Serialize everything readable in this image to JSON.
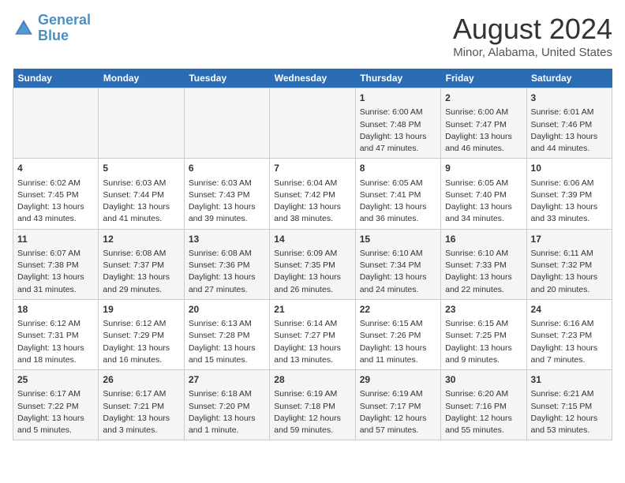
{
  "header": {
    "logo_line1": "General",
    "logo_line2": "Blue",
    "title": "August 2024",
    "subtitle": "Minor, Alabama, United States"
  },
  "days_of_week": [
    "Sunday",
    "Monday",
    "Tuesday",
    "Wednesday",
    "Thursday",
    "Friday",
    "Saturday"
  ],
  "weeks": [
    [
      {
        "day": "",
        "sunrise": "",
        "sunset": "",
        "daylight": ""
      },
      {
        "day": "",
        "sunrise": "",
        "sunset": "",
        "daylight": ""
      },
      {
        "day": "",
        "sunrise": "",
        "sunset": "",
        "daylight": ""
      },
      {
        "day": "",
        "sunrise": "",
        "sunset": "",
        "daylight": ""
      },
      {
        "day": "1",
        "sunrise": "Sunrise: 6:00 AM",
        "sunset": "Sunset: 7:48 PM",
        "daylight": "Daylight: 13 hours and 47 minutes."
      },
      {
        "day": "2",
        "sunrise": "Sunrise: 6:00 AM",
        "sunset": "Sunset: 7:47 PM",
        "daylight": "Daylight: 13 hours and 46 minutes."
      },
      {
        "day": "3",
        "sunrise": "Sunrise: 6:01 AM",
        "sunset": "Sunset: 7:46 PM",
        "daylight": "Daylight: 13 hours and 44 minutes."
      }
    ],
    [
      {
        "day": "4",
        "sunrise": "Sunrise: 6:02 AM",
        "sunset": "Sunset: 7:45 PM",
        "daylight": "Daylight: 13 hours and 43 minutes."
      },
      {
        "day": "5",
        "sunrise": "Sunrise: 6:03 AM",
        "sunset": "Sunset: 7:44 PM",
        "daylight": "Daylight: 13 hours and 41 minutes."
      },
      {
        "day": "6",
        "sunrise": "Sunrise: 6:03 AM",
        "sunset": "Sunset: 7:43 PM",
        "daylight": "Daylight: 13 hours and 39 minutes."
      },
      {
        "day": "7",
        "sunrise": "Sunrise: 6:04 AM",
        "sunset": "Sunset: 7:42 PM",
        "daylight": "Daylight: 13 hours and 38 minutes."
      },
      {
        "day": "8",
        "sunrise": "Sunrise: 6:05 AM",
        "sunset": "Sunset: 7:41 PM",
        "daylight": "Daylight: 13 hours and 36 minutes."
      },
      {
        "day": "9",
        "sunrise": "Sunrise: 6:05 AM",
        "sunset": "Sunset: 7:40 PM",
        "daylight": "Daylight: 13 hours and 34 minutes."
      },
      {
        "day": "10",
        "sunrise": "Sunrise: 6:06 AM",
        "sunset": "Sunset: 7:39 PM",
        "daylight": "Daylight: 13 hours and 33 minutes."
      }
    ],
    [
      {
        "day": "11",
        "sunrise": "Sunrise: 6:07 AM",
        "sunset": "Sunset: 7:38 PM",
        "daylight": "Daylight: 13 hours and 31 minutes."
      },
      {
        "day": "12",
        "sunrise": "Sunrise: 6:08 AM",
        "sunset": "Sunset: 7:37 PM",
        "daylight": "Daylight: 13 hours and 29 minutes."
      },
      {
        "day": "13",
        "sunrise": "Sunrise: 6:08 AM",
        "sunset": "Sunset: 7:36 PM",
        "daylight": "Daylight: 13 hours and 27 minutes."
      },
      {
        "day": "14",
        "sunrise": "Sunrise: 6:09 AM",
        "sunset": "Sunset: 7:35 PM",
        "daylight": "Daylight: 13 hours and 26 minutes."
      },
      {
        "day": "15",
        "sunrise": "Sunrise: 6:10 AM",
        "sunset": "Sunset: 7:34 PM",
        "daylight": "Daylight: 13 hours and 24 minutes."
      },
      {
        "day": "16",
        "sunrise": "Sunrise: 6:10 AM",
        "sunset": "Sunset: 7:33 PM",
        "daylight": "Daylight: 13 hours and 22 minutes."
      },
      {
        "day": "17",
        "sunrise": "Sunrise: 6:11 AM",
        "sunset": "Sunset: 7:32 PM",
        "daylight": "Daylight: 13 hours and 20 minutes."
      }
    ],
    [
      {
        "day": "18",
        "sunrise": "Sunrise: 6:12 AM",
        "sunset": "Sunset: 7:31 PM",
        "daylight": "Daylight: 13 hours and 18 minutes."
      },
      {
        "day": "19",
        "sunrise": "Sunrise: 6:12 AM",
        "sunset": "Sunset: 7:29 PM",
        "daylight": "Daylight: 13 hours and 16 minutes."
      },
      {
        "day": "20",
        "sunrise": "Sunrise: 6:13 AM",
        "sunset": "Sunset: 7:28 PM",
        "daylight": "Daylight: 13 hours and 15 minutes."
      },
      {
        "day": "21",
        "sunrise": "Sunrise: 6:14 AM",
        "sunset": "Sunset: 7:27 PM",
        "daylight": "Daylight: 13 hours and 13 minutes."
      },
      {
        "day": "22",
        "sunrise": "Sunrise: 6:15 AM",
        "sunset": "Sunset: 7:26 PM",
        "daylight": "Daylight: 13 hours and 11 minutes."
      },
      {
        "day": "23",
        "sunrise": "Sunrise: 6:15 AM",
        "sunset": "Sunset: 7:25 PM",
        "daylight": "Daylight: 13 hours and 9 minutes."
      },
      {
        "day": "24",
        "sunrise": "Sunrise: 6:16 AM",
        "sunset": "Sunset: 7:23 PM",
        "daylight": "Daylight: 13 hours and 7 minutes."
      }
    ],
    [
      {
        "day": "25",
        "sunrise": "Sunrise: 6:17 AM",
        "sunset": "Sunset: 7:22 PM",
        "daylight": "Daylight: 13 hours and 5 minutes."
      },
      {
        "day": "26",
        "sunrise": "Sunrise: 6:17 AM",
        "sunset": "Sunset: 7:21 PM",
        "daylight": "Daylight: 13 hours and 3 minutes."
      },
      {
        "day": "27",
        "sunrise": "Sunrise: 6:18 AM",
        "sunset": "Sunset: 7:20 PM",
        "daylight": "Daylight: 13 hours and 1 minute."
      },
      {
        "day": "28",
        "sunrise": "Sunrise: 6:19 AM",
        "sunset": "Sunset: 7:18 PM",
        "daylight": "Daylight: 12 hours and 59 minutes."
      },
      {
        "day": "29",
        "sunrise": "Sunrise: 6:19 AM",
        "sunset": "Sunset: 7:17 PM",
        "daylight": "Daylight: 12 hours and 57 minutes."
      },
      {
        "day": "30",
        "sunrise": "Sunrise: 6:20 AM",
        "sunset": "Sunset: 7:16 PM",
        "daylight": "Daylight: 12 hours and 55 minutes."
      },
      {
        "day": "31",
        "sunrise": "Sunrise: 6:21 AM",
        "sunset": "Sunset: 7:15 PM",
        "daylight": "Daylight: 12 hours and 53 minutes."
      }
    ]
  ]
}
